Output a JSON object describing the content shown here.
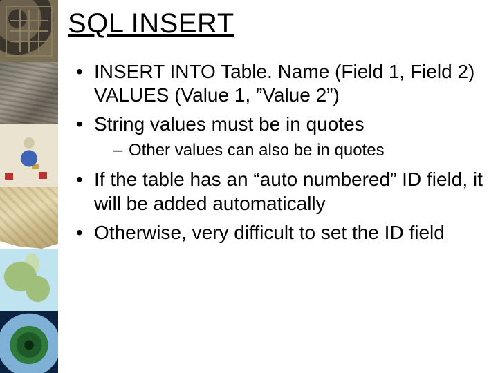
{
  "title": "SQL INSERT",
  "bullets": [
    {
      "text": "INSERT INTO Table. Name (Field 1, Field 2) VALUES (Value 1, ”Value 2”)"
    },
    {
      "text": "String values must be in quotes",
      "sub": [
        "Other values can also be in quotes"
      ]
    },
    {
      "text": "If the table has an “auto numbered” ID field, it will be added automatically"
    },
    {
      "text": "Otherwise, very difficult to set the ID field"
    }
  ],
  "sidebar": {
    "items": [
      {
        "name": "thumb-grid"
      },
      {
        "name": "thumb-tablet"
      },
      {
        "name": "thumb-illustration"
      },
      {
        "name": "thumb-old-map"
      },
      {
        "name": "thumb-region-map"
      },
      {
        "name": "thumb-globe"
      }
    ]
  }
}
